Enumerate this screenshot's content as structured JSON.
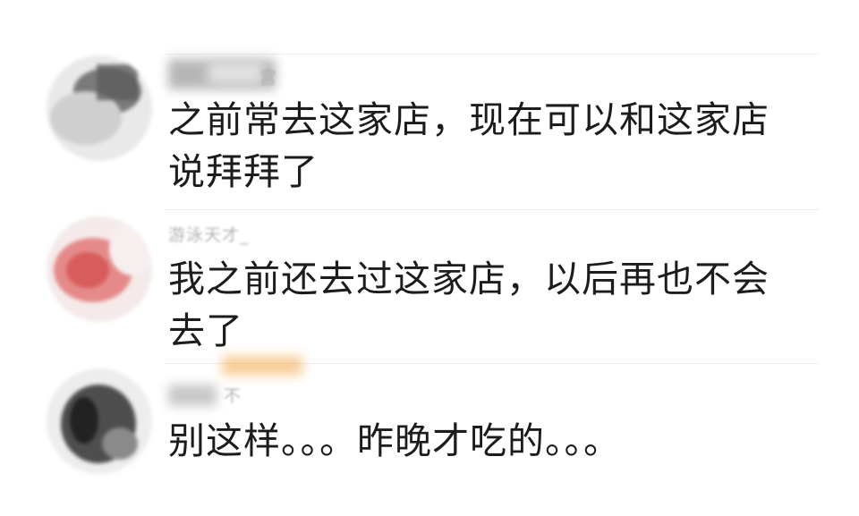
{
  "comments": [
    {
      "username": "宫",
      "text": "之前常去这家店，现在可以和这家店说拜拜了"
    },
    {
      "username": "游泳天才_",
      "text": "我之前还去过这家店，以后再也不会去了"
    },
    {
      "username": "不",
      "text": "别这样。。。昨晚才吃的。。。"
    }
  ],
  "colors": {
    "text": "#1c1c1c",
    "username": "#a6a6a6",
    "divider": "#ececec"
  }
}
